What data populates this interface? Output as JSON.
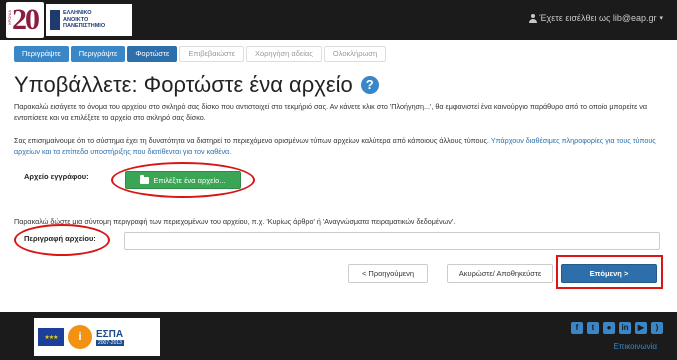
{
  "header": {
    "logo_text": "ΕΛΛΗΝΙΚΟ\nΑΝΟΙΚΤΟ\nΠΑΝΕΠΙΣΤΗΜΙΟ",
    "logo_number": "20",
    "logo_years": "ΧΡΟΝΙΑ",
    "user_label": "Έχετε εισέλθει ως lib@eap.gr",
    "user_icon": "user-icon"
  },
  "progress": [
    {
      "label": "Περιγράψτε",
      "state": "done"
    },
    {
      "label": "Περιγράψτε",
      "state": "done"
    },
    {
      "label": "Φορτώστε",
      "state": "current"
    },
    {
      "label": "Επιβεβαιώστε",
      "state": "todo"
    },
    {
      "label": "Χορηγήση αδείας",
      "state": "todo"
    },
    {
      "label": "Ολοκλήρωση",
      "state": "todo"
    }
  ],
  "main": {
    "title": "Υποβάλλετε: Φορτώστε ένα αρχείο",
    "help_icon": "question-circle-icon",
    "intro": "Παρακαλώ εισάγετε το όνομα του αρχείου στο σκληρό σας δίσκο που αντιστοιχεί στο τεκμήριό σας. Αν κάνετε κλικ στο 'Πλοήγηση...', θα εμφανιστεί ένα καινούργιο παράθυρο από το οποίο μπορείτε να εντοπίσετε και να επιλέξετε το αρχείο στο σκληρό σας δίσκο.",
    "note_text": "Σας επισημαίνουμε ότι το σύστημα έχει τη δυνατότητα να διατηρεί το περιεχόμενο ορισμένων τύπων αρχείων καλύτερα από κάποιους άλλους τύπους.",
    "note_link": "Υπάρχουν διαθέσιμες πληροφορίες για τους τύπους αρχείων και τα επίπεδα υποστήριξης που διατίθενται για τον καθένα.",
    "file_label": "Αρχείο εγγράφου:",
    "upload_button": "Επιλέξτε ένα αρχείο...",
    "description_hint": "Παρακαλώ δώστε μια σύντομη περιγραφή των περιεχομένων του αρχείου, π.χ. 'Κυρίως άρθρο' ή 'Αναγνώσματα πειραματικών δεδομένων'.",
    "description_label": "Περιγραφή αρχείου:",
    "description_value": "",
    "prev_button": "< Προηγούμενη",
    "cancel_button": "Ακυρώστε/ Αποθηκεύστε",
    "next_button": "Επόμενη >"
  },
  "footer": {
    "espa_title": "ΕΣΠΑ",
    "espa_years": "2007-2013",
    "contact": "Επικοινωνία",
    "social_icons": [
      "facebook-icon",
      "twitter-icon",
      "flickr-icon",
      "linkedin-icon",
      "youtube-icon",
      "rss-icon"
    ]
  },
  "colors": {
    "primary": "#2d6fab",
    "success": "#3aa655",
    "annotation": "#d81616",
    "navbar": "#1b1b1b"
  }
}
